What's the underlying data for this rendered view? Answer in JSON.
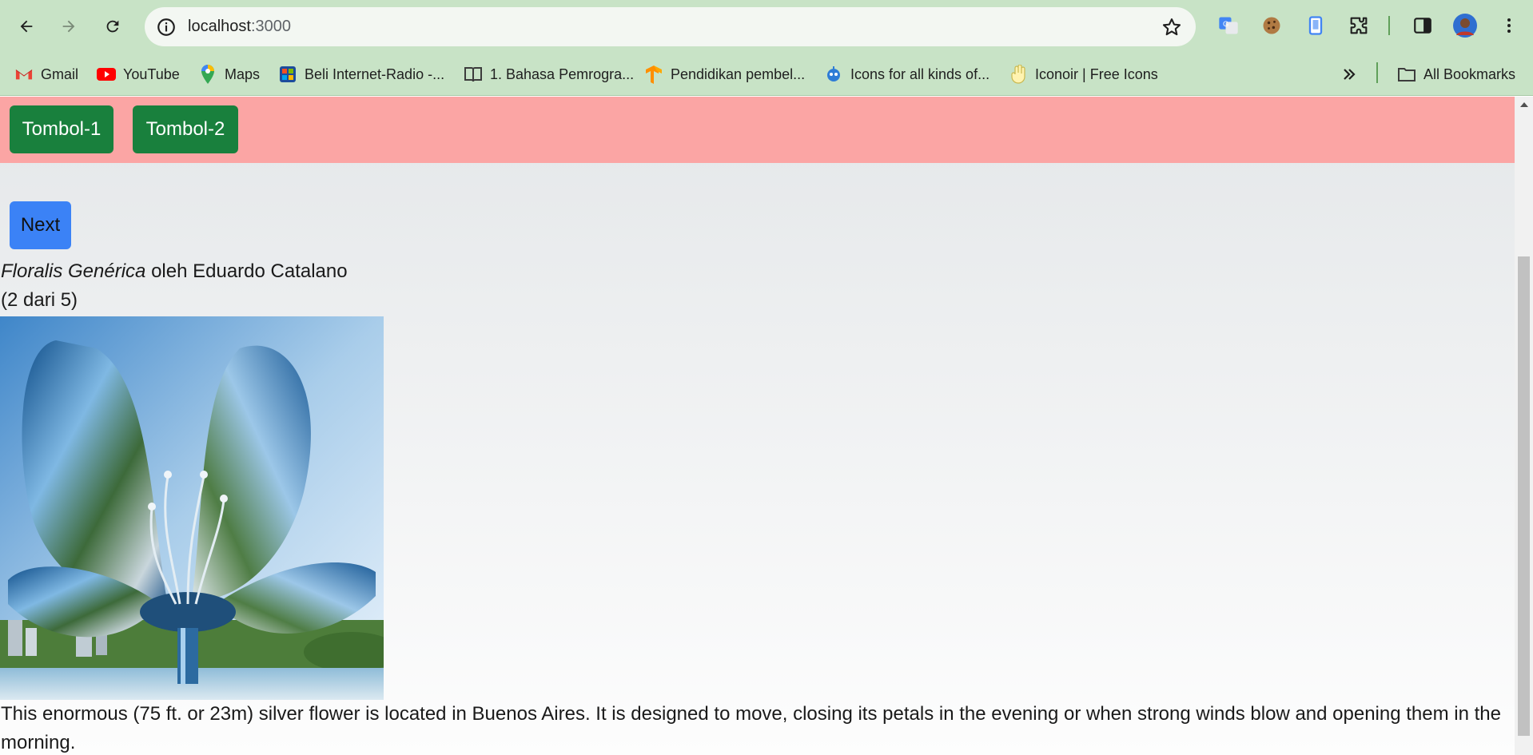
{
  "browser": {
    "url_host": "localhost",
    "url_port": ":3000",
    "bookmarks": [
      {
        "label": "Gmail",
        "icon": "gmail-icon"
      },
      {
        "label": "YouTube",
        "icon": "youtube-icon"
      },
      {
        "label": "Maps",
        "icon": "maps-icon"
      },
      {
        "label": "Beli Internet-Radio -...",
        "icon": "radio-icon"
      },
      {
        "label": "1. Bahasa Pemrogra...",
        "icon": "book-icon"
      },
      {
        "label": "Pendidikan pembel...",
        "icon": "tensorflow-icon"
      },
      {
        "label": "Icons for all kinds of...",
        "icon": "robot-icon"
      },
      {
        "label": "Iconoir | Free Icons",
        "icon": "hand-icon"
      }
    ],
    "all_bookmarks": "All Bookmarks",
    "colors": {
      "chrome": "#c8e3c6",
      "omnibox": "#f3f7f2"
    }
  },
  "page": {
    "buttons": {
      "tombol1": "Tombol-1",
      "tombol2": "Tombol-2",
      "next": "Next"
    },
    "sculpture": {
      "title": "Floralis Genérica",
      "artist_prefix": " oleh ",
      "artist": "Eduardo Catalano",
      "counter": "(2 dari 5)",
      "description": "This enormous (75 ft. or 23m) silver flower is located in Buenos Aires. It is designed to move, closing its petals in the evening or when strong winds blow and opening them in the morning."
    },
    "colors": {
      "topbar": "#fba5a4",
      "green_button": "#19803d",
      "next_button": "#3b82f6"
    }
  }
}
